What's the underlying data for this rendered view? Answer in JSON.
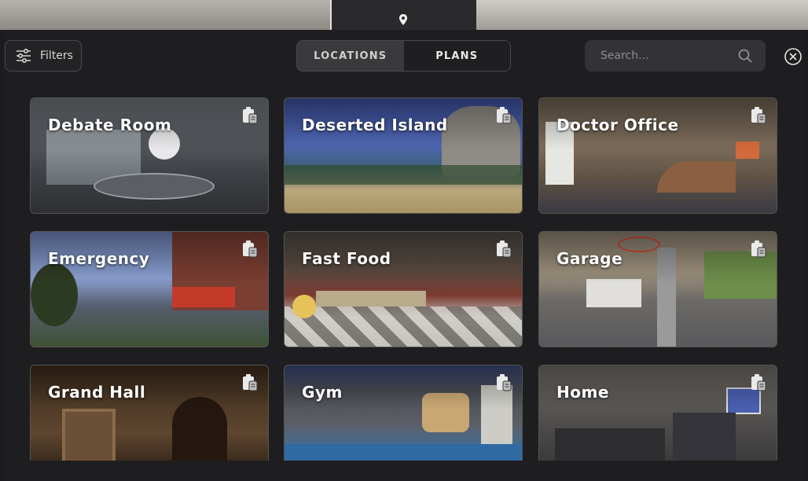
{
  "header": {
    "filters_label": "Filters",
    "tabs": [
      {
        "label": "LOCATIONS",
        "active": true
      },
      {
        "label": "PLANS",
        "active": false
      }
    ],
    "search_placeholder": "Search...",
    "close_icon": "close-circle-icon"
  },
  "cards": [
    {
      "title": "Debate Room"
    },
    {
      "title": "Deserted Island"
    },
    {
      "title": "Doctor Office"
    },
    {
      "title": "Emergency"
    },
    {
      "title": "Fast Food"
    },
    {
      "title": "Garage"
    },
    {
      "title": "Grand Hall"
    },
    {
      "title": "Gym"
    },
    {
      "title": "Home"
    }
  ],
  "icons": {
    "pin": "location-pin-icon",
    "filters": "sliders-icon",
    "search": "search-icon",
    "card_badge": "clipboard-icon"
  }
}
